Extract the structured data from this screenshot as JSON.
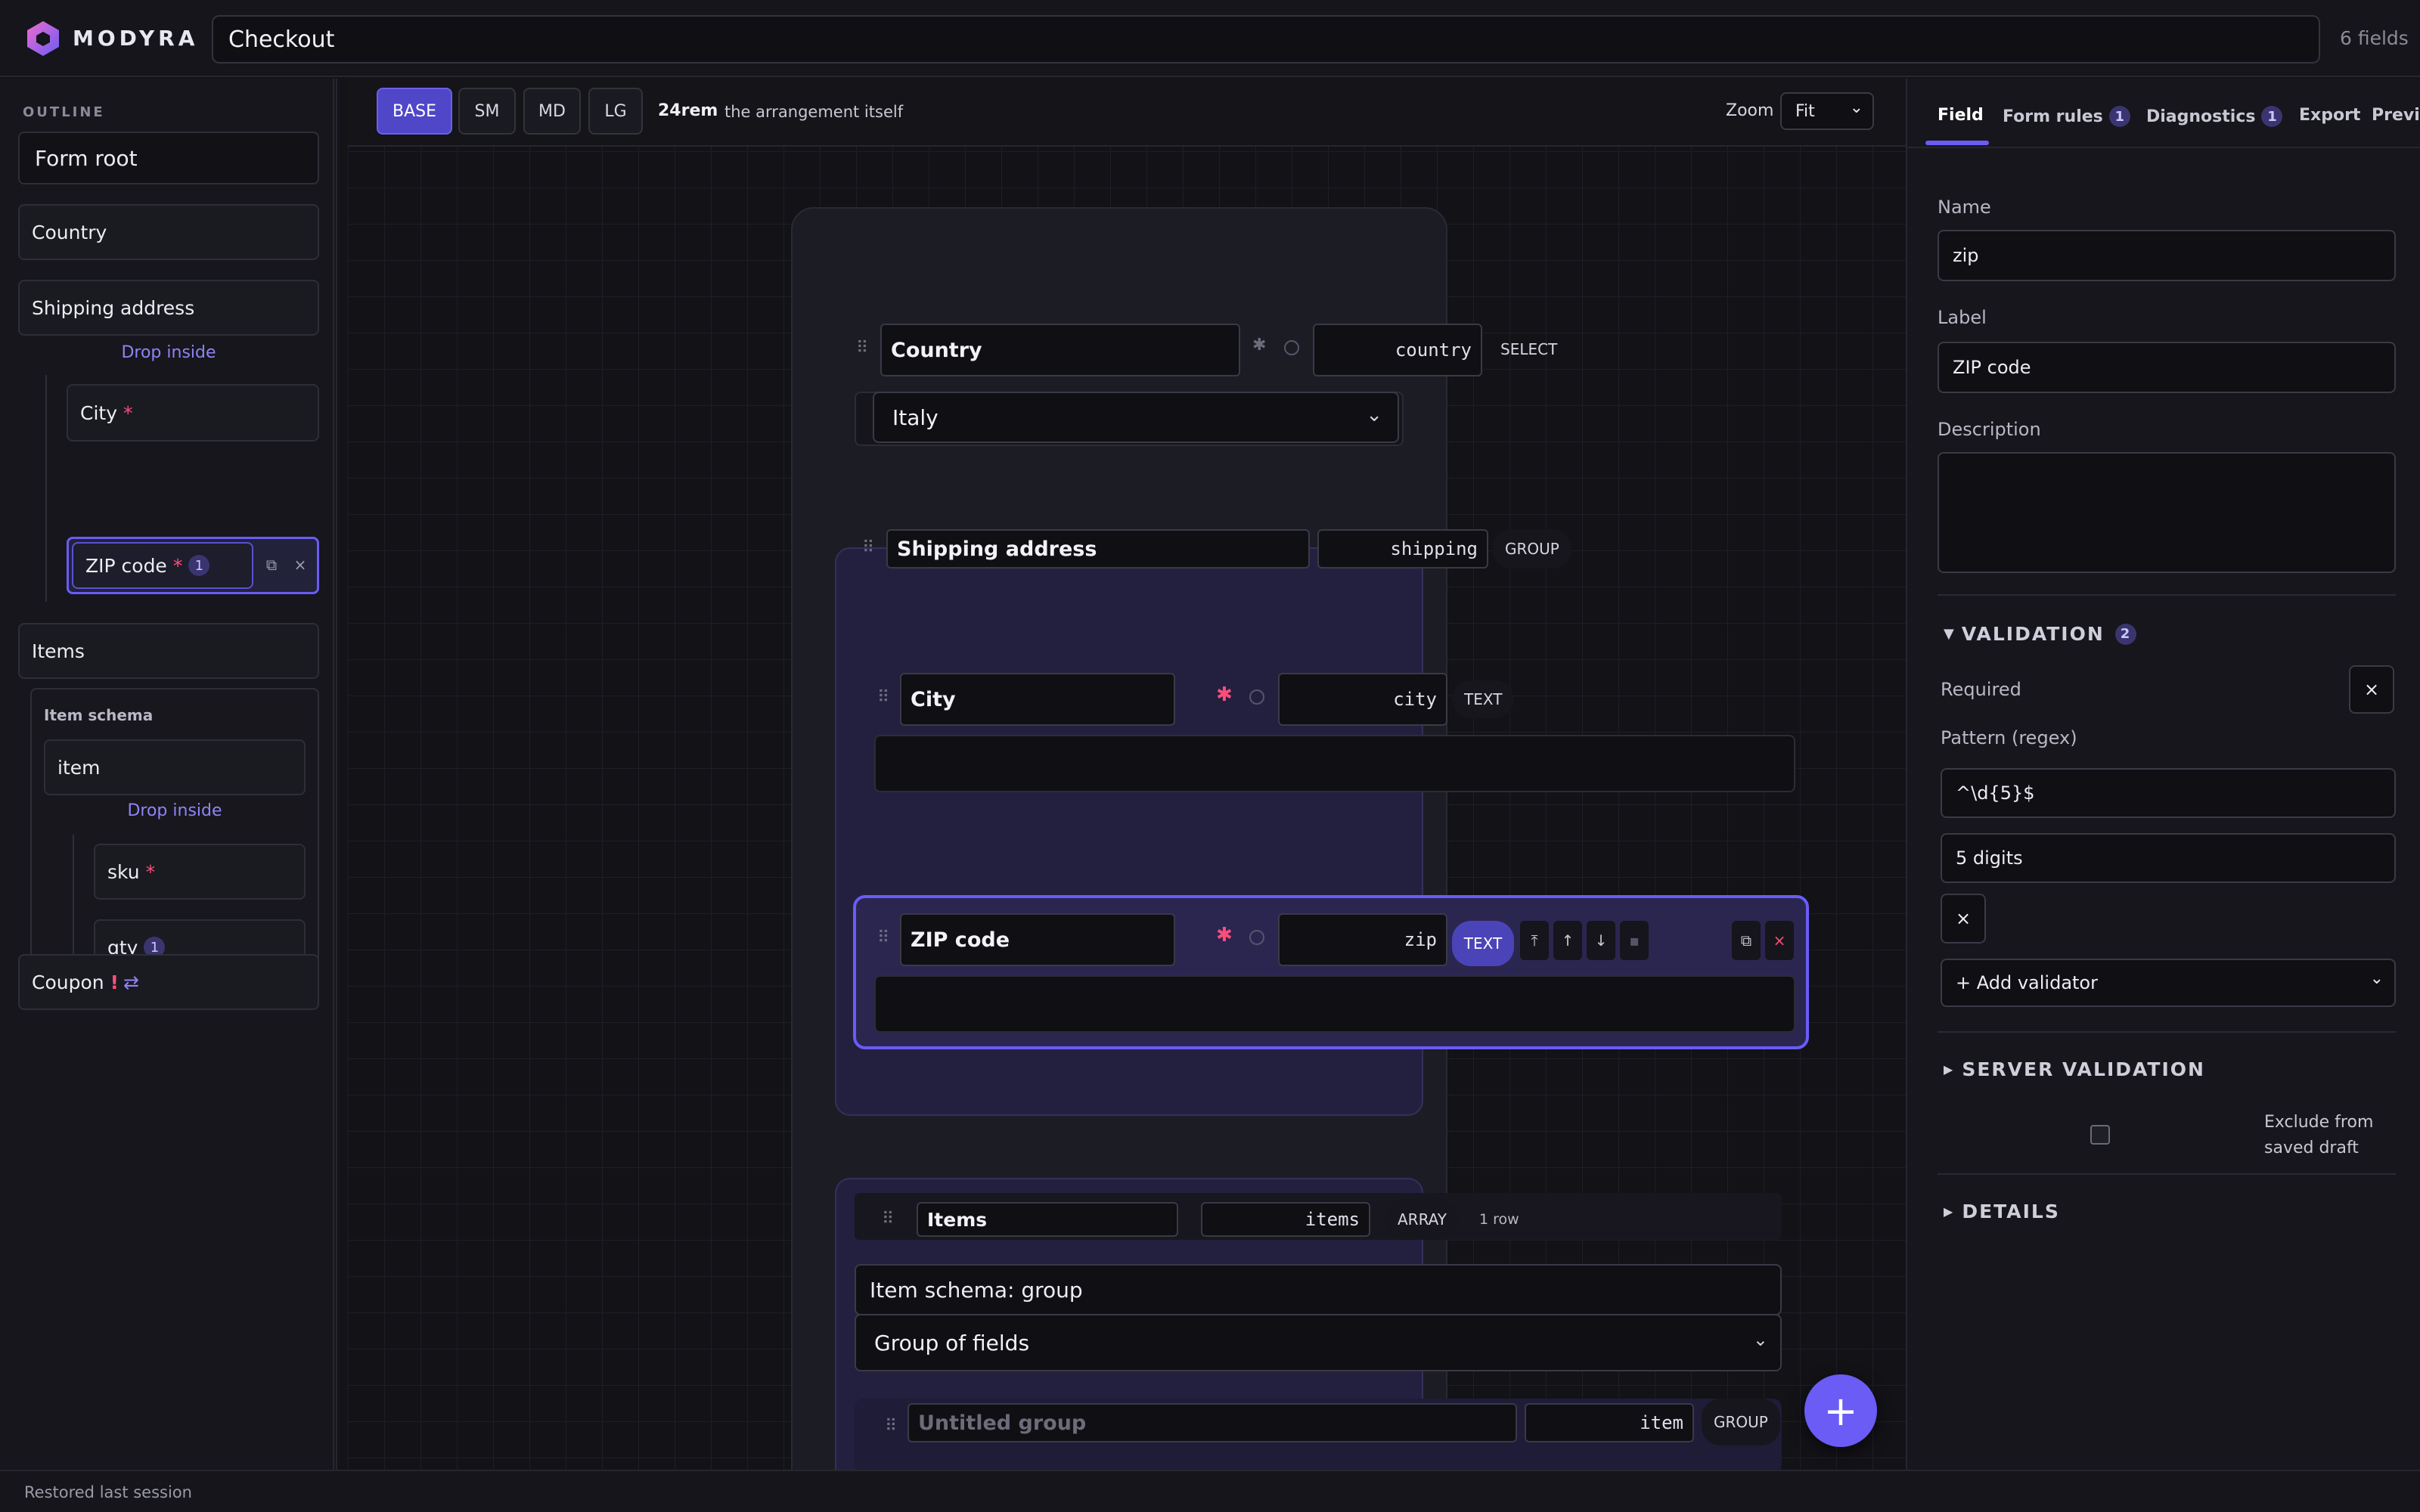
{
  "brand": {
    "name": "MODYRA"
  },
  "header": {
    "form_title": "Checkout",
    "field_count": "6 fields"
  },
  "outline": {
    "label": "OUTLINE",
    "root": "Form root",
    "items": {
      "country": "Country",
      "shipping": "Shipping address",
      "drop_inside": "Drop inside",
      "city": "City",
      "zip": "ZIP code",
      "zip_badge": "1",
      "items": "Items",
      "item_schema": "Item schema",
      "item": "item",
      "drop_inside_2": "Drop inside",
      "sku": "sku",
      "qty": "qty",
      "qty_badge": "1",
      "coupon": "Coupon",
      "coupon_mark": "!",
      "coupon_icon": "⇄"
    },
    "required_mark": "*"
  },
  "canvas_bar": {
    "breakpoints": [
      "BASE",
      "SM",
      "MD",
      "LG"
    ],
    "width": "24rem",
    "width_note": "the arrangement itself",
    "zoom_label": "Zoom",
    "zoom_value": "Fit"
  },
  "canvas": {
    "country": {
      "label": "Country",
      "key": "country",
      "type": "SELECT",
      "value": "Italy"
    },
    "shipping": {
      "label": "Shipping address",
      "key": "shipping",
      "type": "GROUP"
    },
    "city": {
      "label": "City",
      "key": "city",
      "type": "TEXT"
    },
    "zip": {
      "label": "ZIP code",
      "key": "zip",
      "type": "TEXT"
    },
    "items": {
      "label": "Items",
      "key": "items",
      "type": "ARRAY",
      "rows": "1 row",
      "schema_title": "Item schema: group",
      "schema_select": "Group of fields"
    },
    "untitled": {
      "placeholder": "Untitled group",
      "key": "item",
      "type": "GROUP"
    },
    "required_mark": "✱",
    "fab": "+"
  },
  "rpanel": {
    "tabs": {
      "field": "Field",
      "rules": "Form rules",
      "rules_badge": "1",
      "diag": "Diagnostics",
      "diag_badge": "1",
      "export": "Export",
      "preview": "Previe"
    },
    "name_label": "Name",
    "name_value": "zip",
    "label_label": "Label",
    "label_value": "ZIP code",
    "desc_label": "Description",
    "validation": {
      "title": "VALIDATION",
      "count": "2",
      "required": "Required",
      "pattern_label": "Pattern (regex)",
      "pattern_value": "^\\d{5}$",
      "message_value": "5 digits",
      "add_validator": "+ Add validator"
    },
    "server_validation": "SERVER VALIDATION",
    "exclude_label": "Exclude from saved draft",
    "details": "DETAILS",
    "close": "×"
  },
  "status": {
    "text": "Restored last session"
  },
  "colors": {
    "accent": "#6a5cf5",
    "required": "#ff4d7a",
    "background": "#131318"
  }
}
